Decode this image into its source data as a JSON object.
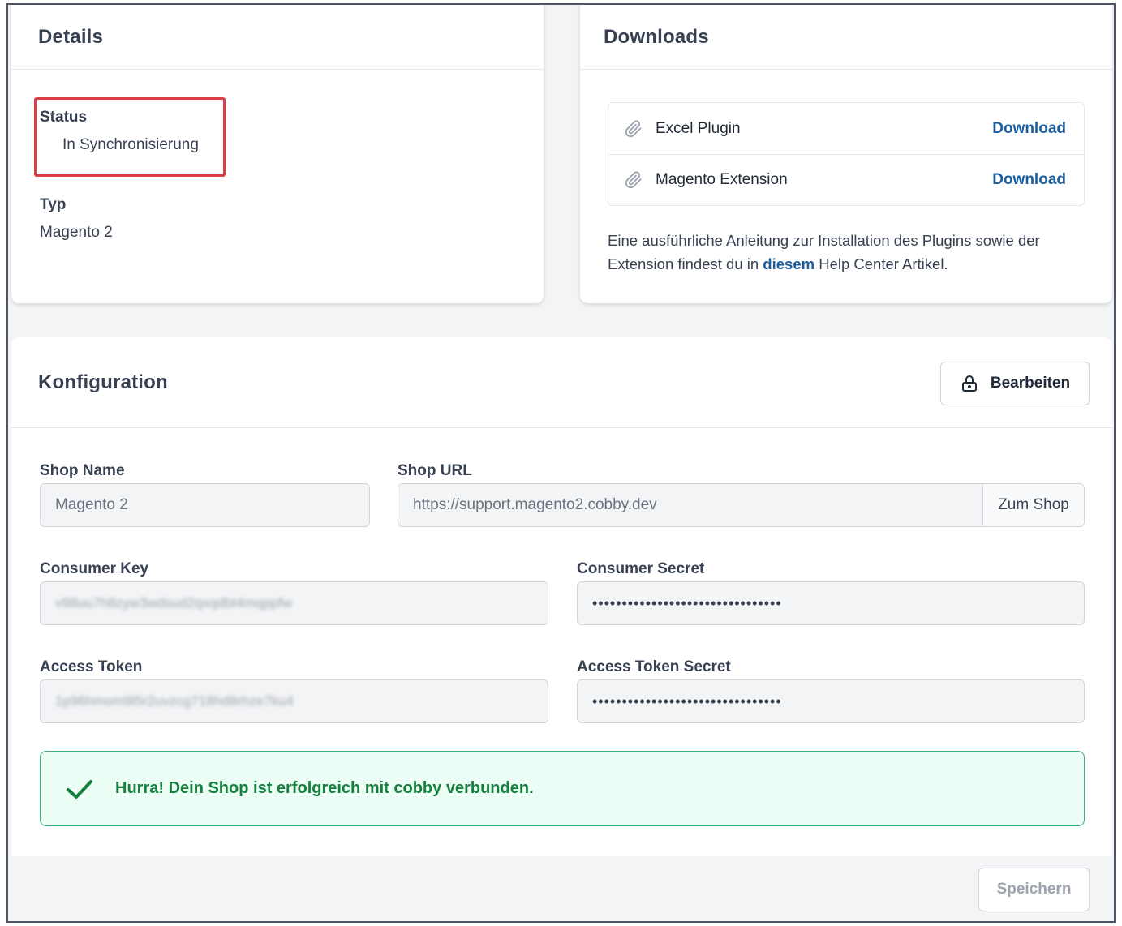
{
  "details": {
    "title": "Details",
    "status_label": "Status",
    "status_value": "In Synchronisierung",
    "type_label": "Typ",
    "type_value": "Magento 2"
  },
  "downloads": {
    "title": "Downloads",
    "items": [
      {
        "name": "Excel Plugin",
        "action": "Download",
        "icon": "paperclip-icon"
      },
      {
        "name": "Magento Extension",
        "action": "Download",
        "icon": "paperclip-icon"
      }
    ],
    "note_before": "Eine ausführliche Anleitung zur Installation des Plugins sowie der Extension findest du in ",
    "note_link": "diesem",
    "note_after": " Help Center Artikel."
  },
  "config": {
    "title": "Konfiguration",
    "edit_label": "Bearbeiten",
    "shop_name_label": "Shop Name",
    "shop_name_value": "Magento 2",
    "shop_url_label": "Shop URL",
    "shop_url_value": "https://support.magento2.cobby.dev",
    "shop_url_addon": "Zum Shop",
    "consumer_key_label": "Consumer Key",
    "consumer_key_value": "v98uu7h8zyw3wdsud2qxqdbt4mqppfw",
    "consumer_secret_label": "Consumer Secret",
    "consumer_secret_value": "••••••••••••••••••••••••••••••••",
    "access_token_label": "Access Token",
    "access_token_value": "1p96hmom9l5r2uvzcg718hd8rhze7ku4",
    "access_token_secret_label": "Access Token Secret",
    "access_token_secret_value": "••••••••••••••••••••••••••••••••",
    "success_message": "Hurra! Dein Shop ist erfolgreich mit cobby verbunden.",
    "save_label": "Speichern"
  },
  "colors": {
    "link": "#1b5fa0",
    "success_text": "#15803d",
    "success_border": "#34b37a",
    "highlight_border": "#dc3f45"
  }
}
